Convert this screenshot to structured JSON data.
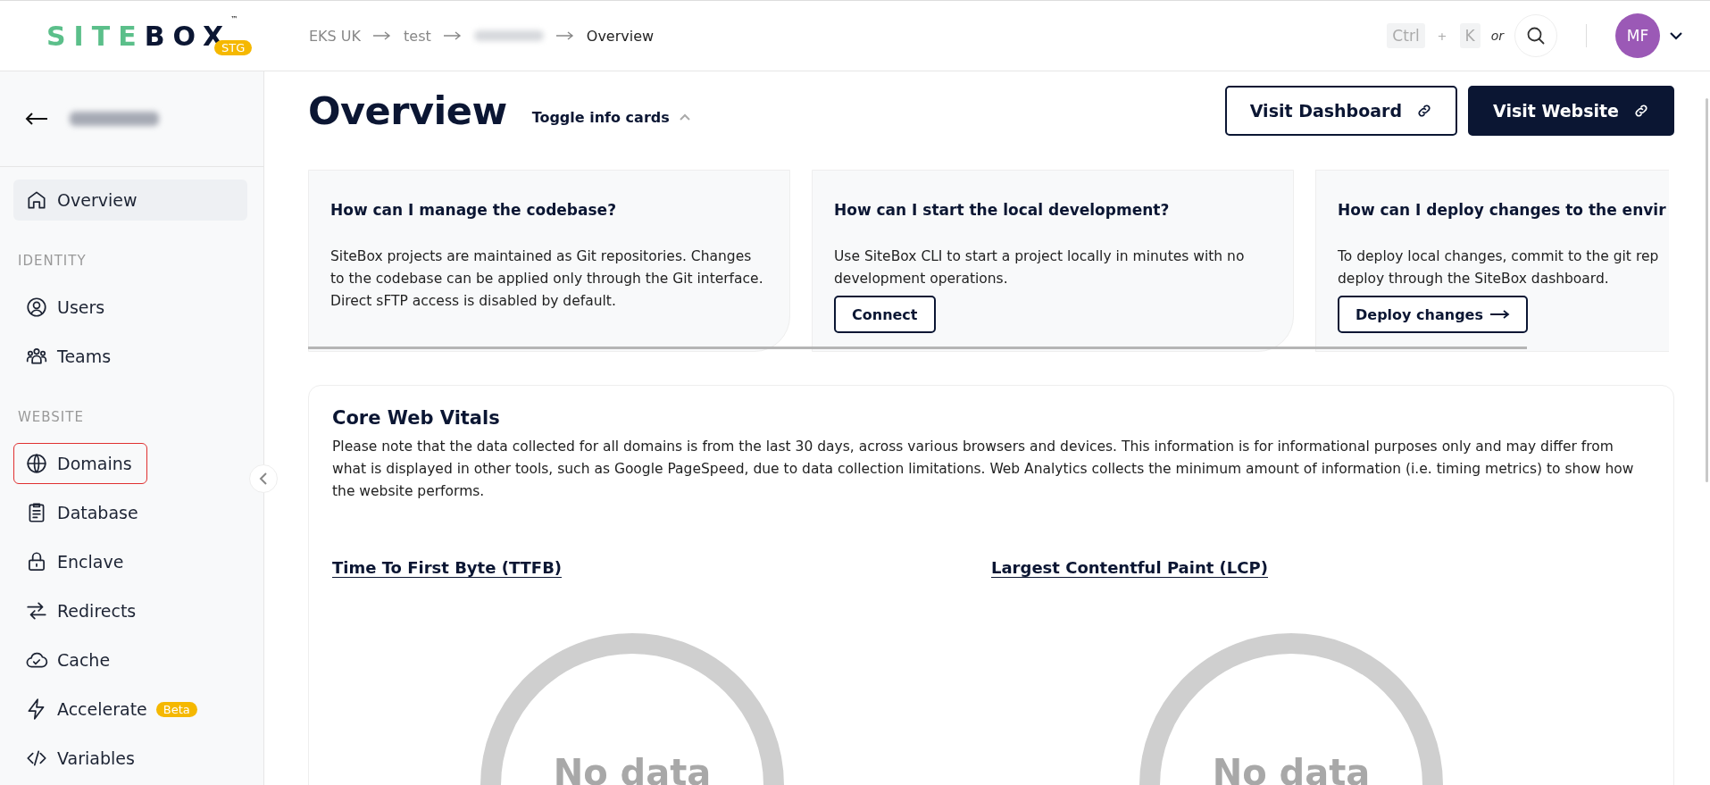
{
  "header": {
    "logo": {
      "primary": "SITE",
      "secondary": "BOX",
      "mark": "™",
      "badge": "STG"
    },
    "breadcrumbs": [
      {
        "kind": "text",
        "label": "EKS UK"
      },
      {
        "kind": "text",
        "label": "test"
      },
      {
        "kind": "redacted"
      },
      {
        "kind": "current",
        "label": "Overview"
      }
    ],
    "shortcut": {
      "keys": [
        "Ctrl",
        "K"
      ],
      "plus": "+",
      "or": "or"
    },
    "avatar": {
      "initials": "MF"
    }
  },
  "sidebar": {
    "back": {
      "kind": "redacted"
    },
    "sections": [
      {
        "items": [
          {
            "label": "Overview",
            "kind": "home",
            "selected": true,
            "outlined": false
          }
        ]
      },
      {
        "heading": "IDENTITY",
        "items": [
          {
            "label": "Users",
            "kind": "user",
            "selected": false,
            "outlined": false
          },
          {
            "label": "Teams",
            "kind": "team",
            "selected": false,
            "outlined": false
          }
        ]
      },
      {
        "heading": "WEBSITE",
        "items": [
          {
            "label": "Domains",
            "kind": "globe",
            "selected": false,
            "outlined": true
          },
          {
            "label": "Database",
            "kind": "clipboard",
            "selected": false,
            "outlined": false
          },
          {
            "label": "Enclave",
            "kind": "lock",
            "selected": false,
            "outlined": false
          },
          {
            "label": "Redirects",
            "kind": "arrows",
            "selected": false,
            "outlined": false
          },
          {
            "label": "Cache",
            "kind": "cloud",
            "selected": false,
            "outlined": false
          },
          {
            "label": "Accelerate",
            "kind": "bolt",
            "selected": false,
            "outlined": false,
            "badge": "Beta"
          },
          {
            "label": "Variables",
            "kind": "code",
            "selected": false,
            "outlined": false
          }
        ]
      }
    ]
  },
  "page": {
    "title": "Overview",
    "toggle": {
      "label": "Toggle info cards",
      "expanded": true
    },
    "buttons": [
      {
        "kind": "outline",
        "label": "Visit Dashboard"
      },
      {
        "kind": "solid",
        "label": "Visit Website"
      }
    ]
  },
  "info_cards": [
    {
      "title": "How can I manage the codebase?",
      "body": "SiteBox projects are maintained as Git repositories. Changes to the codebase can be applied only through the Git interface. Direct sFTP access is disabled by default."
    },
    {
      "title": "How can I start the local development?",
      "body": "Use SiteBox CLI to start a project locally in minutes with no development operations.",
      "button": {
        "label": "Connect",
        "arrow": false
      }
    },
    {
      "title": "How can I deploy changes to the envir",
      "body": "To deploy local changes, commit to the git rep deploy through the SiteBox dashboard.",
      "button": {
        "label": "Deploy changes",
        "arrow": true
      }
    }
  ],
  "vitals": {
    "title": "Core Web Vitals",
    "description": "Please note that the data collected for all domains is from the last 30 days, across various browsers and devices. This information is for informational purposes only and may differ from what is displayed in other tools, such as Google PageSpeed, due to data collection limitations. Web Analytics collects the minimum amount of information (i.e. timing metrics) to show how the website performs.",
    "metrics": [
      {
        "title": "Time To First Byte (TTFB)",
        "value": "No data"
      },
      {
        "title": "Largest Contentful Paint (LCP)",
        "value": "No data"
      }
    ]
  }
}
